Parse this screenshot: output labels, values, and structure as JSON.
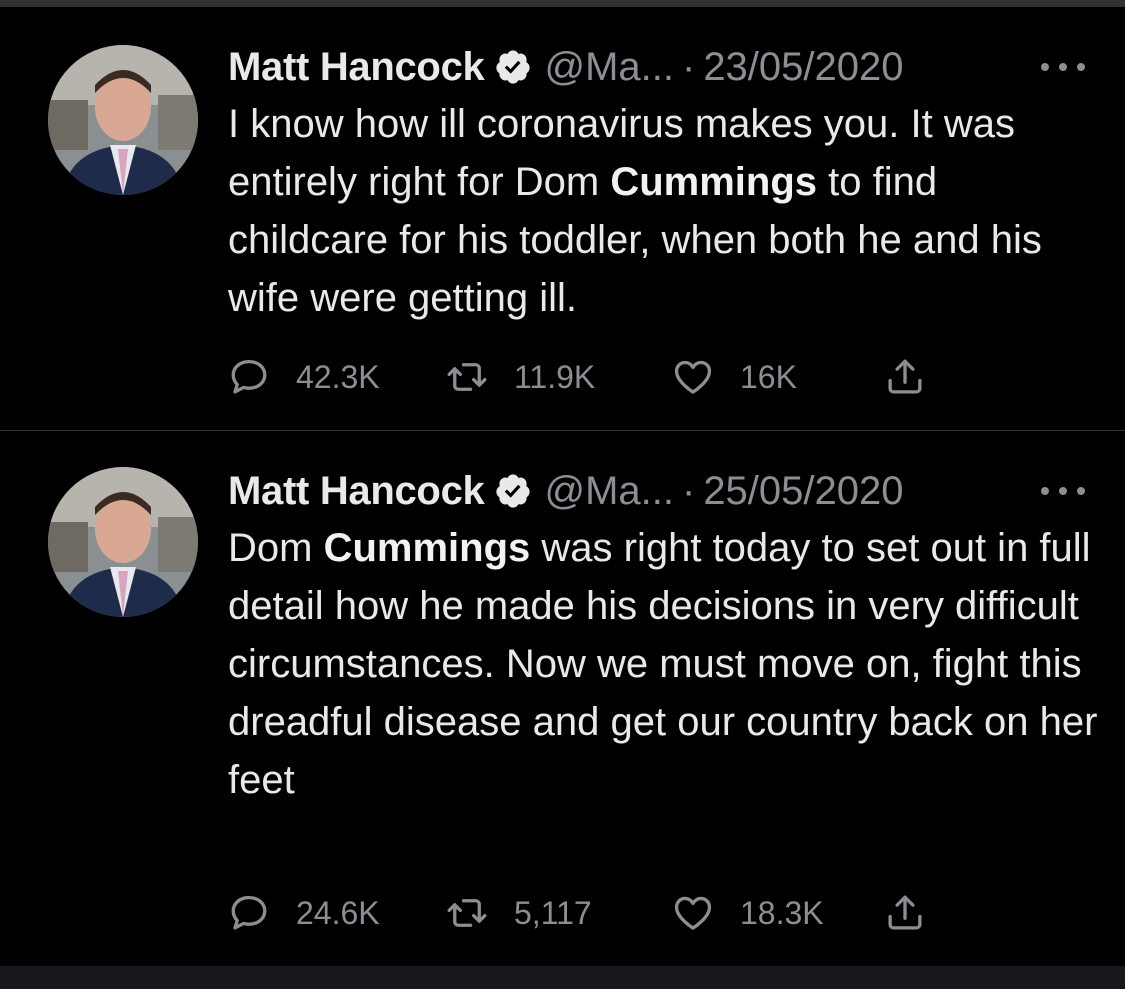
{
  "colors": {
    "background": "#000000",
    "text": "#e7e9ea",
    "muted": "#8b8f94",
    "divider": "#2f3336"
  },
  "tweets": [
    {
      "author_name": "Matt Hancock",
      "handle": "@Ma...",
      "separator": "·",
      "date": "23/05/2020",
      "text_before": "I know how ill coronavirus makes you. It was entirely right for Dom ",
      "text_bold": "Cummings",
      "text_after": " to find childcare for his toddler, when both he and his wife were getting ill.",
      "replies": "42.3K",
      "retweets": "11.9K",
      "likes": "16K",
      "icons": [
        "verified-badge-icon",
        "more-dots-icon",
        "reply-icon",
        "retweet-icon",
        "like-icon",
        "share-icon"
      ]
    },
    {
      "author_name": "Matt Hancock",
      "handle": "@Ma...",
      "separator": "·",
      "date": "25/05/2020",
      "text_before": "Dom ",
      "text_bold": "Cummings",
      "text_after": " was right today to set out in full detail how he made his decisions in very difficult circumstances. Now we must move on, fight this dreadful disease and get our country back on her feet",
      "replies": "24.6K",
      "retweets": "5,117",
      "likes": "18.3K",
      "icons": [
        "verified-badge-icon",
        "more-dots-icon",
        "reply-icon",
        "retweet-icon",
        "like-icon",
        "share-icon"
      ]
    }
  ]
}
